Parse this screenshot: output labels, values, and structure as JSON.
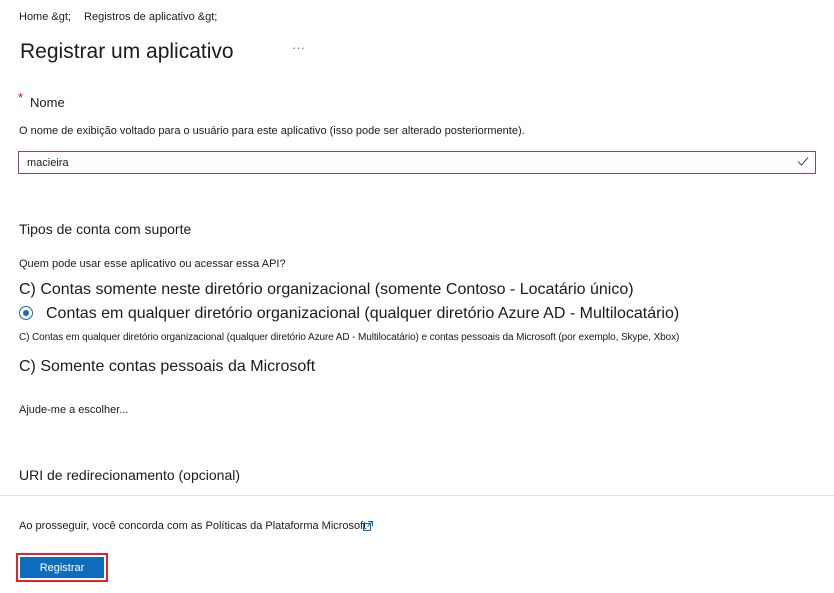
{
  "breadcrumb": {
    "home": "Home &gt;",
    "registrations": "Registros de aplicativo &gt;"
  },
  "header": {
    "title": "Registrar um aplicativo",
    "more_icon": "ellipsis-icon",
    "more_glyph": "···"
  },
  "name_section": {
    "required_mark": "*",
    "label": "Nome",
    "description": "O nome de exibição voltado para o usuário para este aplicativo (isso pode ser alterado posteriormente).",
    "input_value": "macieira",
    "input_icon": "check-icon"
  },
  "account_types": {
    "title": "Tipos de conta com suporte",
    "question": "Quem pode usar esse aplicativo ou acessar essa API?",
    "option_single_tenant": "C) Contas somente neste diretório organizacional (somente Contoso - Locatário único)",
    "option_multitenant": "Contas em qualquer diretório organizacional (qualquer diretório Azure AD - Multilocatário)",
    "option_multitenant_personal": "C) Contas  em qualquer diretório organizacional  (qualquer diretório Azure AD - Multilocatário)  e contas  pessoais da Microsoft (por exemplo, Skype, Xbox)",
    "option_personal_only": "C) Somente contas pessoais da Microsoft",
    "selected": "option_multitenant",
    "help_link": "Ajude-me a escolher..."
  },
  "redirect": {
    "label": "URI de redirecionamento (opcional)"
  },
  "footer": {
    "terms": "Ao prosseguir, você concorda com as Políticas da Plataforma Microsoft",
    "terms_icon": "external-link-icon",
    "register_label": "Registrar"
  },
  "colors": {
    "accent": "#0f6cbd",
    "input_border": "#8a3e92",
    "required": "#c50f1f",
    "highlight_outline": "#e3222c"
  }
}
